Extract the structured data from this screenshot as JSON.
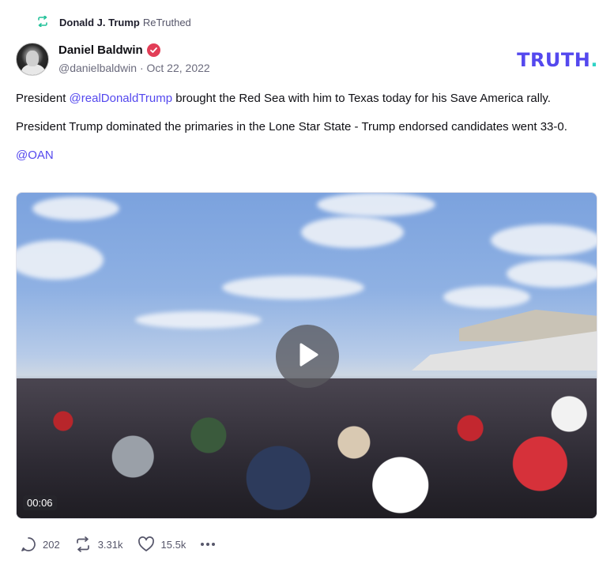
{
  "retruth": {
    "name": "Donald J. Trump",
    "suffix": "ReTruthed"
  },
  "author": {
    "name": "Daniel Baldwin",
    "handle": "@danielbaldwin",
    "separator": " · ",
    "date": "Oct 22, 2022",
    "verified": true
  },
  "brand": {
    "logo_main": "TRUTH",
    "logo_dot": ".",
    "logo_color": "#5448ee",
    "dot_color": "#2fd3c6"
  },
  "post": {
    "p1_before": "President ",
    "p1_mention": "@realDonaldTrump",
    "p1_after": " brought the Red Sea with him to Texas today for his Save America rally.",
    "p2": "President Trump dominated the primaries in the Lone Star State - Trump endorsed candidates went 33-0.",
    "p3_mention": "@OAN"
  },
  "video": {
    "duration": "00:06",
    "play_icon": "play-icon"
  },
  "actions": {
    "replies": "202",
    "retruths": "3.31k",
    "likes": "15.5k"
  },
  "colors": {
    "accent": "#5448ee",
    "retruth_icon": "#24c29a",
    "verified": "#e23e57"
  }
}
